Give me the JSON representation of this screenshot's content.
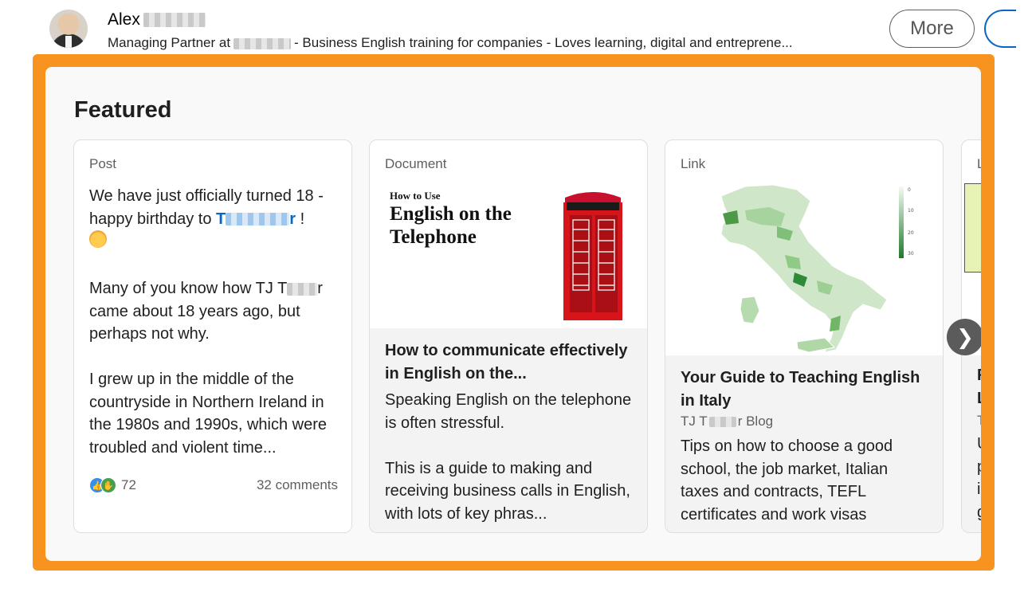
{
  "profile": {
    "name": "Alex",
    "headline_before": "Managing Partner at",
    "headline_after": "- Business English training for companies - Loves learning, digital and entreprene...",
    "more_label": "More"
  },
  "featured": {
    "title": "Featured",
    "next_label": "❯",
    "post": {
      "type": "Post",
      "line1": "We have just officially turned 18",
      "line2_prefix": "- happy birthday to",
      "mention_start": "T",
      "mention_end": "r",
      "line2_suffix": "!",
      "para2_a": "Many of you know how TJ",
      "para2_b_start": "T",
      "para2_b_end": "r came about 18 years ago, but perhaps not why.",
      "para3": "I grew up in the middle of the countryside in Northern Ireland in the 1980s and 1990s, which were troubled and violent time...",
      "reactions": "72",
      "comments": "32 comments"
    },
    "document": {
      "type": "Document",
      "image_howto": "How to Use",
      "image_title": "English on the Telephone",
      "title": "How to communicate effectively in English on the...",
      "desc1": "Speaking English on the telephone is often stressful.",
      "desc2": "This is a guide to making and receiving business calls in English, with lots of key phras..."
    },
    "link": {
      "type": "Link",
      "title": "Your Guide to Teaching English in Italy",
      "source_start": "TJ T",
      "source_end": "r Blog",
      "desc": "Tips on how to choose a good school, the job market, Italian taxes and contracts, TEFL certificates and work visas",
      "scale_labels": [
        "0",
        "10",
        "20",
        "30"
      ]
    },
    "partial_card": {
      "type": "L",
      "lines": [
        "F",
        "L",
        "T",
        "U",
        "p",
        "i",
        "g"
      ]
    }
  },
  "colors": {
    "highlight": "#f7931e",
    "link_blue": "#0a66c2",
    "map_green": "#2e8b3a"
  }
}
